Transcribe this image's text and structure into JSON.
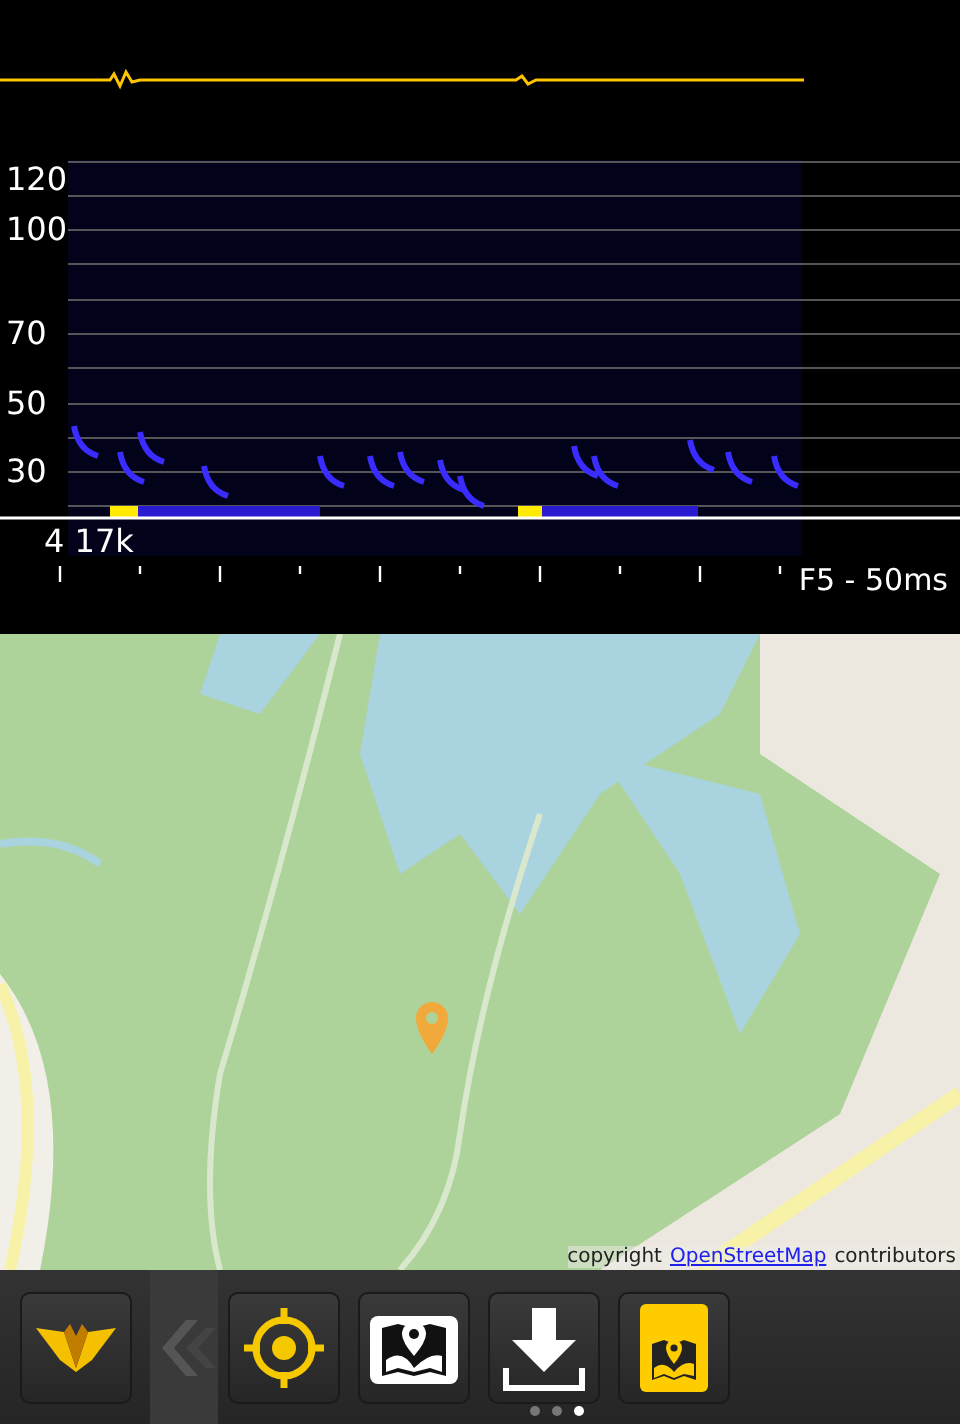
{
  "spectrogram": {
    "y_labels": [
      "120",
      "100",
      "70",
      "50",
      "30"
    ],
    "range_label": "4 17k",
    "time_label": "F5 - 50ms"
  },
  "map": {
    "kind": "picture",
    "attribution": {
      "prefix": "copyright",
      "link": "OpenStreetMap",
      "suffix": "contributors"
    }
  },
  "toolbar": {
    "buttons": [
      {
        "kind": "logo"
      },
      {
        "kind": "back"
      },
      {
        "kind": "locate"
      },
      {
        "kind": "map"
      },
      {
        "kind": "download"
      },
      {
        "kind": "map_on"
      }
    ],
    "pages": [
      {
        "selected": false
      },
      {
        "selected": false
      },
      {
        "selected": true
      }
    ]
  }
}
